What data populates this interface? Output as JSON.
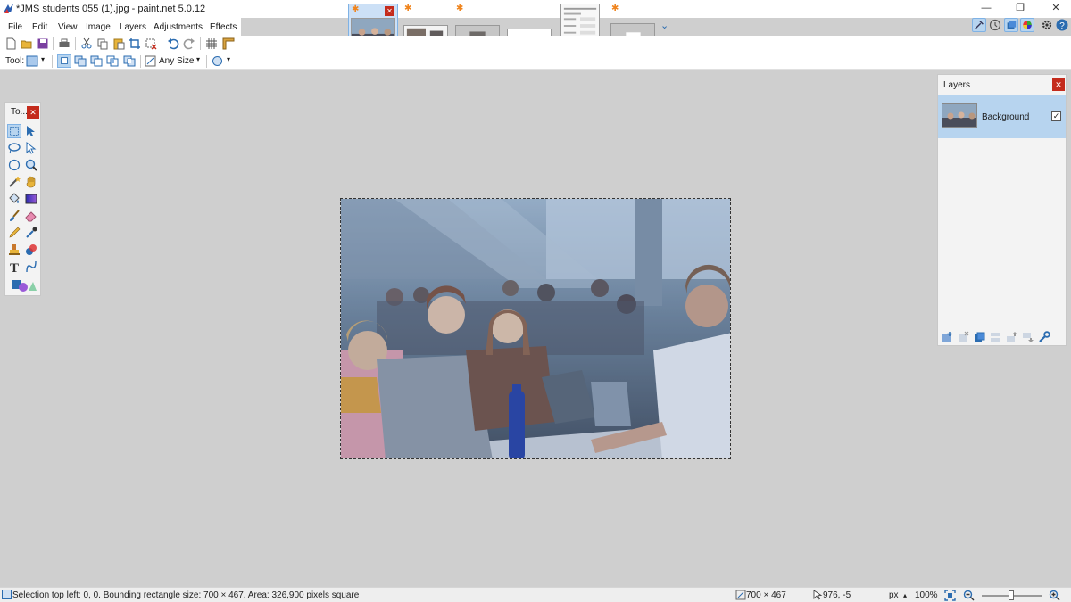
{
  "window": {
    "title": "*JMS students 055 (1).jpg - paint.net 5.0.12",
    "minimize": "—",
    "restore": "❐",
    "close": "✕"
  },
  "menu": [
    "File",
    "Edit",
    "View",
    "Image",
    "Layers",
    "Adjustments",
    "Effects"
  ],
  "thumbnails": [
    {
      "modified": "✱",
      "active": true,
      "close": "✕"
    },
    {
      "modified": "✱",
      "active": false
    },
    {
      "modified": "✱",
      "active": false
    },
    {
      "modified": "",
      "active": false
    },
    {
      "modified": "✱",
      "active": false
    },
    {
      "modified": "✱",
      "active": false
    }
  ],
  "thumb_overflow": "⌄",
  "options": {
    "tool_label": "Tool:",
    "dropdown_arrow": "▾",
    "size_label": "Any Size"
  },
  "tools_window": {
    "title": "To...",
    "close": "✕"
  },
  "layers_window": {
    "title": "Layers",
    "close": "✕",
    "layers": [
      {
        "name": "Background",
        "visible_mark": "✓"
      }
    ]
  },
  "status": {
    "message": "Selection top left: 0, 0. Bounding rectangle size: 700 × 467. Area: 326,900 pixels square",
    "size": "700 × 467",
    "cursor": "976, -5",
    "units": "px",
    "units_arrow": "▴",
    "zoom": "100%"
  },
  "colors": {
    "accent": "#2b6cb0",
    "close_red": "#c42b1c",
    "selected_layer": "#b7d4ef",
    "workspace": "#cfcfcf"
  }
}
